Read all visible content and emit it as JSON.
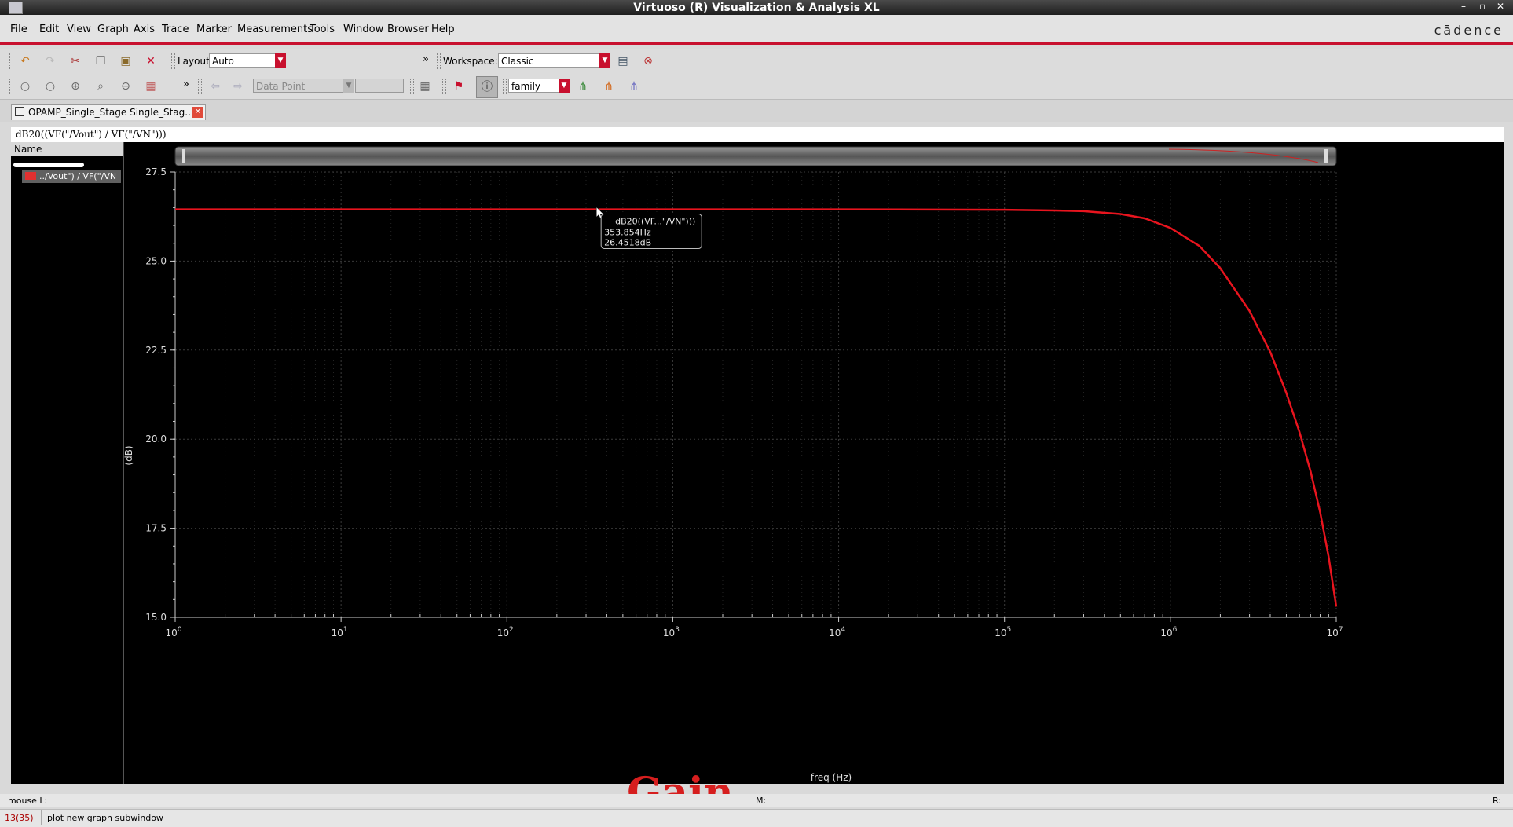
{
  "window": {
    "title": "Virtuoso (R) Visualization & Analysis XL",
    "controls": [
      "–",
      "▫",
      "✕"
    ]
  },
  "menubar": {
    "items": [
      "File",
      "Edit",
      "View",
      "Graph",
      "Axis",
      "Trace",
      "Marker",
      "Measurements",
      "Tools",
      "Window",
      "Browser",
      "Help"
    ],
    "brand": "cādence"
  },
  "toolbar1": {
    "layout_label": "Layout:",
    "layout_value": "Auto",
    "overflow": "»",
    "workspace_label": "Workspace:",
    "workspace_value": "Classic"
  },
  "toolbar2": {
    "overflow": "»",
    "marker_type_value": "Data Point",
    "family_value": "family"
  },
  "tab": {
    "label": "OPAMP_Single_Stage Single_Stag...",
    "close": "✕"
  },
  "expression": "dB20((VF(\"/Vout\") / VF(\"/VN\")))",
  "trace_browser": {
    "header": "Name",
    "trace_label": "../Vout\") / VF(\"/VN"
  },
  "marker": {
    "title": "dB20((VF...\"/VN\")))",
    "x_value": "353.854Hz",
    "y_value": "26.4518dB"
  },
  "status": {
    "mouse_left": "mouse L:",
    "mouse_middle": "M:",
    "mouse_right": "R:",
    "line_number": "13(35)",
    "message": "plot new graph subwindow"
  },
  "overlay_label": "Gain",
  "chart_data": {
    "type": "line",
    "title": "",
    "xlabel": "freq (Hz)",
    "ylabel": "(dB)",
    "xscale": "log",
    "xlim": [
      1,
      10000000
    ],
    "ylim": [
      15.0,
      27.5
    ],
    "x_tick_labels": [
      {
        "base": "10",
        "exp": "0"
      },
      {
        "base": "10",
        "exp": "1"
      },
      {
        "base": "10",
        "exp": "2"
      },
      {
        "base": "10",
        "exp": "3"
      },
      {
        "base": "10",
        "exp": "4"
      },
      {
        "base": "10",
        "exp": "5"
      },
      {
        "base": "10",
        "exp": "6"
      },
      {
        "base": "10",
        "exp": "7"
      }
    ],
    "y_tick_labels": [
      "27.5",
      "25.0",
      "22.5",
      "20.0",
      "17.5",
      "15.0"
    ],
    "grid": true,
    "series": [
      {
        "name": "dB20((VF(\"/Vout\") / VF(\"/VN\")))",
        "color": "#e8141e",
        "x": [
          1,
          10,
          100,
          1000,
          10000,
          100000,
          200000,
          300000,
          500000,
          700000,
          1000000,
          1500000,
          2000000,
          3000000,
          4000000,
          5000000,
          6000000,
          7000000,
          8000000,
          9000000,
          10000000
        ],
        "y": [
          26.45,
          26.45,
          26.45,
          26.45,
          26.45,
          26.44,
          26.42,
          26.4,
          26.32,
          26.2,
          25.93,
          25.42,
          24.8,
          23.6,
          22.45,
          21.3,
          20.2,
          19.1,
          17.95,
          16.7,
          15.3
        ]
      }
    ]
  }
}
